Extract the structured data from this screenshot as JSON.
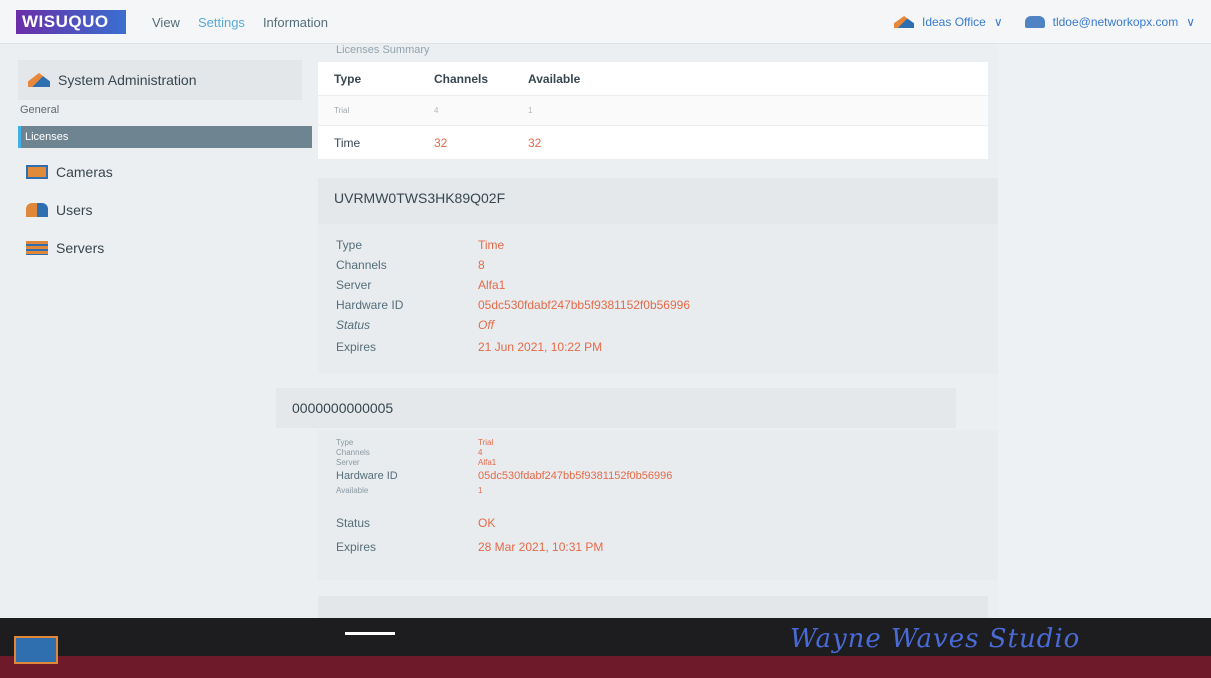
{
  "header": {
    "logo": "WISUQUO",
    "nav": [
      "View",
      "Settings",
      "Information"
    ],
    "active_nav": "Settings",
    "tenant": "Ideas Office",
    "user": "tldoe@networkopx.com"
  },
  "sidebar": {
    "section": "System Administration",
    "sub_general": "General",
    "sub_licenses": "Licenses",
    "items": [
      "Cameras",
      "Users",
      "Servers"
    ]
  },
  "summary": {
    "heading": "Licenses Summary",
    "columns": [
      "Type",
      "Channels",
      "Available"
    ],
    "rows": [
      {
        "type": "Trial",
        "channels": "4",
        "available": "1"
      },
      {
        "type": "Time",
        "channels": "32",
        "available": "32"
      }
    ]
  },
  "license1": {
    "id": "UVRMW0TWS3HK89Q02F",
    "fields": [
      {
        "k": "Type",
        "v": "Time"
      },
      {
        "k": "Channels",
        "v": "8"
      },
      {
        "k": "Server",
        "v": "Alfa1"
      },
      {
        "k": "Hardware ID",
        "v": "05dc530fdabf247bb5f9381152f0b56996"
      },
      {
        "k": "Status",
        "v": "Off"
      },
      {
        "k": "Expires",
        "v": "21 Jun 2021, 10:22 PM"
      }
    ]
  },
  "license2": {
    "id": "0000000000005",
    "fields_small": [
      {
        "k": "Type",
        "v": "Trial"
      },
      {
        "k": "Channels",
        "v": "4"
      },
      {
        "k": "Server",
        "v": "Alfa1"
      }
    ],
    "hardware_label": "Hardware ID",
    "hardware_value": "05dc530fdabf247bb5f9381152f0b56996",
    "available_label": "Available",
    "available_value": "1",
    "status_label": "Status",
    "status_value": "OK",
    "expires_label": "Expires",
    "expires_value": "28 Mar 2021, 10:31 PM"
  },
  "footer": {
    "script": "Wayne Waves Studio"
  }
}
